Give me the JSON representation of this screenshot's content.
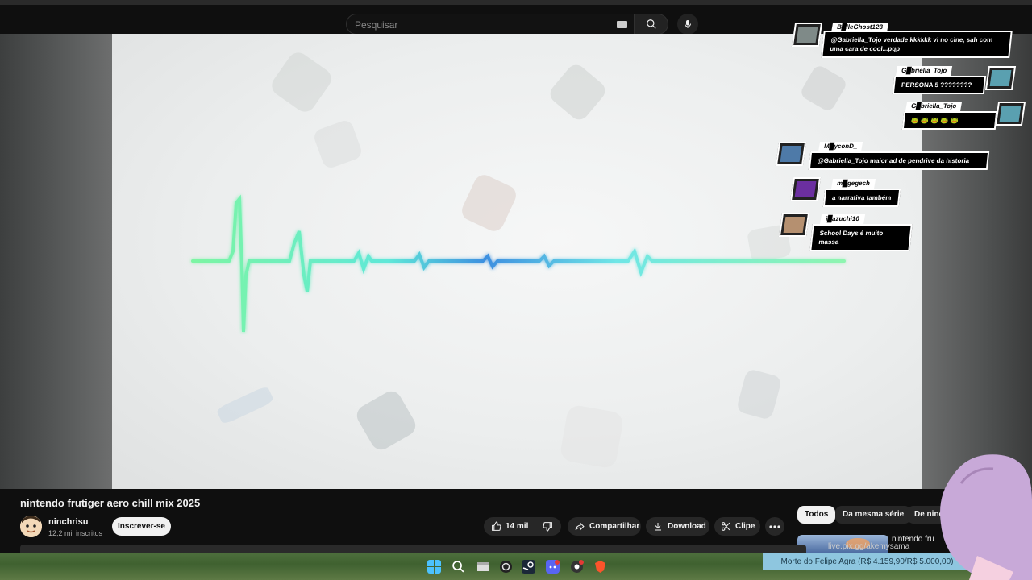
{
  "search": {
    "placeholder": "Pesquisar"
  },
  "video": {
    "title": "nintendo frutiger aero chill mix 2025",
    "channel": "ninchrisu",
    "subscribers": "12,2 mil inscritos",
    "subscribe_label": "Inscrever-se",
    "likes": "14 mil",
    "share_label": "Compartilhar",
    "download_label": "Download",
    "clip_label": "Clipe"
  },
  "chips": [
    "Todos",
    "Da mesma série",
    "De ninc"
  ],
  "recommended": {
    "title": "nintendo fru"
  },
  "overlay": {
    "live_text": "live.pix.gg/akemysama",
    "donation": "Morte do Felipe Agra (R$ 4.159,90/R$ 5.000,00)"
  },
  "chat": [
    {
      "user": "B█lleGhost123",
      "text": "@Gabriella_Tojo verdade kkkkkk vi no cine, sah com uma cara de cool...pqp"
    },
    {
      "user": "G█briella_Tojo",
      "text": "PERSONA 5 ????????"
    },
    {
      "user": "G█briella_Tojo",
      "text": "🐸 🐸 🐸 🐸 🐸"
    },
    {
      "user": "M█yconD_",
      "text": "@Gabriella_Tojo maior ad de pendrive da historia"
    },
    {
      "user": "m█gegech",
      "text": "a narrativa também"
    },
    {
      "user": "i█azuchi10",
      "text": "School Days é muito massa"
    }
  ],
  "colors": {
    "waveform": "#5ff0c8",
    "accent": "#3ea6ff",
    "background": "#0f0f0f"
  },
  "icons": {
    "search": "search-icon",
    "mic": "mic-icon",
    "like": "thumbs-up-icon",
    "dislike": "thumbs-down-icon",
    "share": "share-icon",
    "download": "download-icon",
    "clip": "scissors-icon",
    "more": "more-icon"
  }
}
